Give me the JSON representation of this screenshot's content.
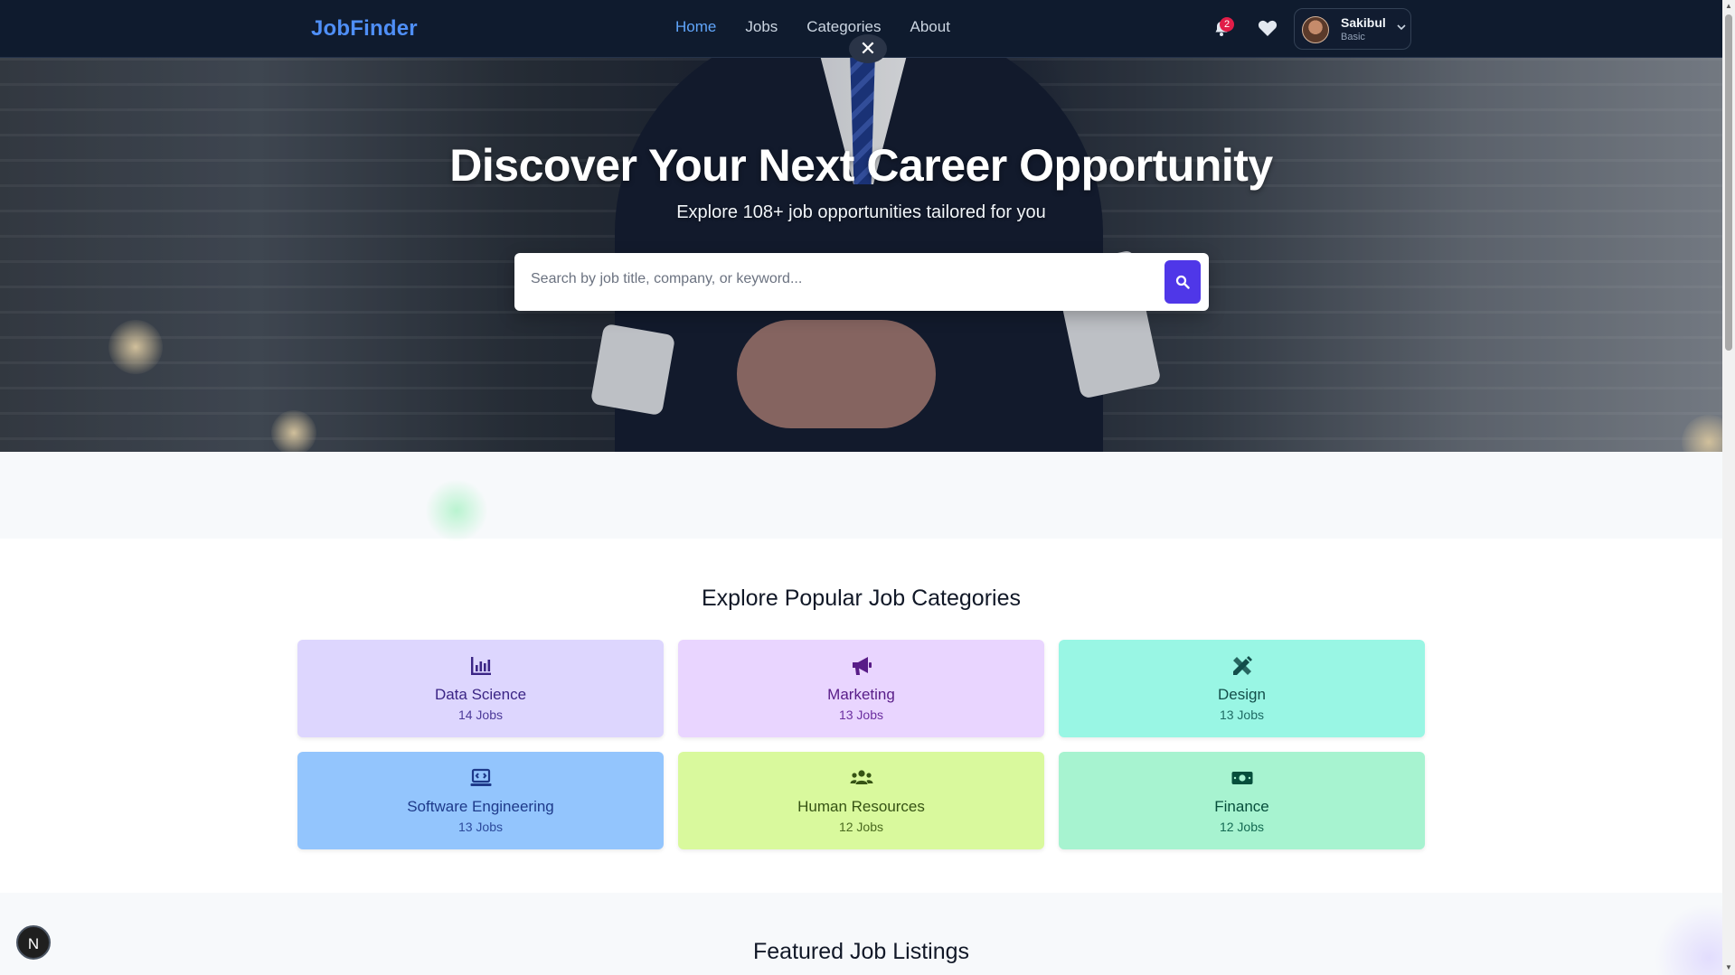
{
  "navbar": {
    "logo": "JobFinder",
    "links": [
      {
        "label": "Home",
        "active": true
      },
      {
        "label": "Jobs",
        "active": false
      },
      {
        "label": "Categories",
        "active": false
      },
      {
        "label": "About",
        "active": false
      }
    ],
    "close_icon": "close-icon",
    "notifications": {
      "icon": "bell-icon",
      "count": "2"
    },
    "favorites_icon": "heart-icon",
    "user": {
      "name": "Sakibul",
      "plan": "Basic",
      "caret_icon": "chevron-down-icon"
    }
  },
  "hero": {
    "title": "Discover Your Next Career Opportunity",
    "subtitle": "Explore 108+ job opportunities tailored for you",
    "search": {
      "placeholder": "Search by job title, company, or keyword...",
      "value": "",
      "button_icon": "search-icon"
    }
  },
  "categories": {
    "title": "Explore Popular Job Categories",
    "items": [
      {
        "name": "Data Science",
        "count": "14 Jobs",
        "icon": "chart-bar-icon",
        "bg": "#ddd6fe",
        "fg": "#3b2585",
        "sub": "#4c3a99"
      },
      {
        "name": "Marketing",
        "count": "13 Jobs",
        "icon": "megaphone-icon",
        "bg": "#e9d5ff",
        "fg": "#581c87",
        "sub": "#6b2fa0"
      },
      {
        "name": "Design",
        "count": "13 Jobs",
        "icon": "pencil-ruler-icon",
        "bg": "#99f6e4",
        "fg": "#134e4a",
        "sub": "#1f6b64"
      },
      {
        "name": "Software Engineering",
        "count": "13 Jobs",
        "icon": "laptop-code-icon",
        "bg": "#93c5fd",
        "fg": "#1e3a8a",
        "sub": "#2c4a9c"
      },
      {
        "name": "Human Resources",
        "count": "12 Jobs",
        "icon": "users-icon",
        "bg": "#d9f99d",
        "fg": "#365314",
        "sub": "#4a6a1f"
      },
      {
        "name": "Finance",
        "count": "12 Jobs",
        "icon": "money-bill-icon",
        "bg": "#a7f3d0",
        "fg": "#064e3b",
        "sub": "#146a52"
      }
    ]
  },
  "featured": {
    "title": "Featured Job Listings"
  },
  "dev_badge": {
    "label": "N"
  },
  "colors": {
    "accent": "#4f37e8",
    "nav_bg": "#0f1b2e",
    "logo": "#4f8ff7",
    "active_link": "#60a5fa"
  }
}
